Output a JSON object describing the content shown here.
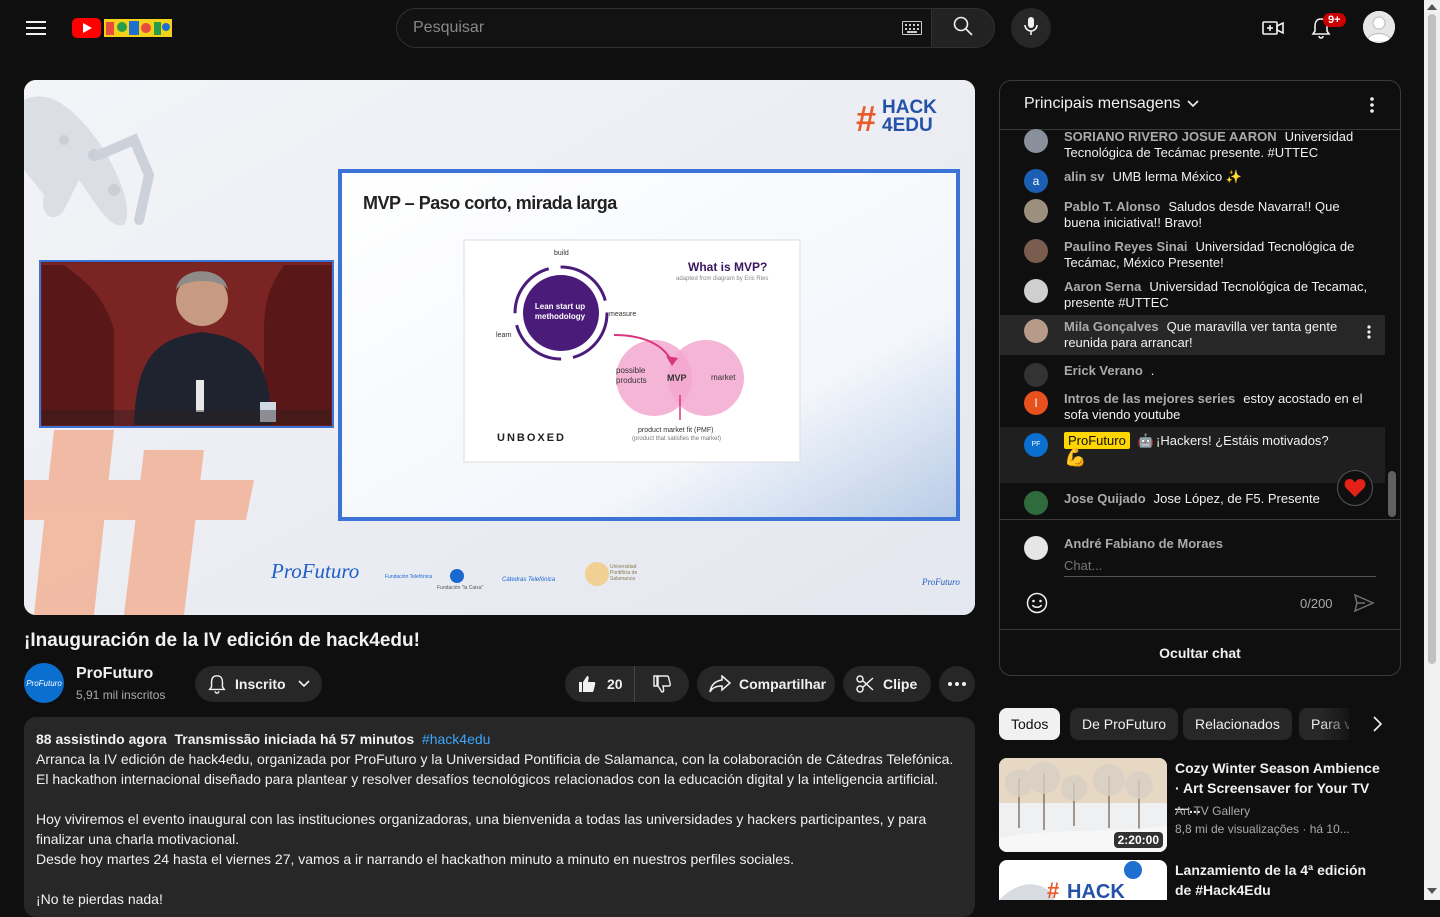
{
  "header": {
    "search_placeholder": "Pesquisar",
    "notif_count": "9+"
  },
  "video": {
    "slide_title": "MVP – Paso corto, mirada larga",
    "hack_logo_line1": "HACK",
    "hack_logo_line2": "4EDU",
    "mvp_heading": "What is MVP?",
    "mvp_sub": "adapted from diagram by Eric Ries",
    "cycle_center": "Lean start up methodology",
    "cycle_build": "build",
    "cycle_measure": "measure",
    "cycle_learn": "learn",
    "venn_left": "possible products",
    "venn_center": "MVP",
    "venn_right": "market",
    "venn_bottom": "product market fit (PMF)",
    "venn_bottom_sub": "(product that satisfies the market)",
    "unboxed": "UNBOXED",
    "footer_logo": "ProFuturo",
    "sponsor1": "Fundación Telefónica",
    "sponsor2": "Fundación \"la Caixa\"",
    "sponsor3": "Cátedras Telefónica",
    "sponsor4": "Universidad Pontificia de Salamanca",
    "corner_logo": "ProFuturo"
  },
  "title": "¡Inauguración de la IV edición de hack4edu!",
  "channel": {
    "name": "ProFuturo",
    "subs": "5,91 mil inscritos",
    "logo_text": "ProFuturo",
    "subscribed_label": "Inscrito"
  },
  "actions": {
    "likes": "20",
    "share": "Compartilhar",
    "clip": "Clipe"
  },
  "description": {
    "meta_watching": "88 assistindo agora",
    "meta_started": "Transmissão iniciada há 57 minutos",
    "meta_tag": "#hack4edu",
    "p1": "Arranca la IV edición de hack4edu, organizada por ProFuturo y la Universidad Pontificia de Salamanca, con la colaboración de Cátedras Telefónica. El hackathon internacional diseñado para plantear y resolver desafíos tecnológicos relacionados con la educación digital y la inteligencia artificial.",
    "p2": "Hoy viviremos el evento inaugural con las instituciones organizadoras, una bienvenida a todas las universidades y hackers participantes, y para finalizar una charla motivacional.",
    "p3": "Desde hoy martes 24 hasta el viernes 27, vamos a ir narrando el hackathon minuto a minuto en nuestros perfiles sociales.",
    "p4": "¡No te pierdas nada!"
  },
  "chat": {
    "header": "Principais mensagens",
    "messages": [
      {
        "author": "SORIANO RIVERO JOSUE AARON",
        "text": "Universidad Tecnológica de Tecámac presente. #UTTEC",
        "avatar": "",
        "avatar_color": "#8a8f9c"
      },
      {
        "author": "alin sv",
        "text": "UMB lerma México ✨",
        "avatar": "a",
        "avatar_color": "#1a5fb4"
      },
      {
        "author": "Pablo T. Alonso",
        "text": "Saludos desde Navarra!! Que buena iniciativa!! Bravo!",
        "avatar": "",
        "avatar_color": "#9c8f7e"
      },
      {
        "author": "Paulino Reyes Sinai",
        "text": "Universidad Tecnológica de Tecámac, México Presente!",
        "avatar": "",
        "avatar_color": "#7a5c4f"
      },
      {
        "author": "Aaron Serna",
        "text": "Universidad Tecnológica de Tecamac, presente #UTTEC",
        "avatar": "",
        "avatar_color": "#cfcfcf"
      },
      {
        "author": "Mila Gonçalves",
        "text": "Que maravilla ver tanta gente reunida para arrancar!",
        "avatar": "",
        "avatar_color": "#b89a8a"
      },
      {
        "author": "Erick Verano",
        "text": ".",
        "avatar": "",
        "avatar_color": "#333333"
      },
      {
        "author": "Intros de las mejores series",
        "text": "estoy acostado en el sofa viendo youtube",
        "avatar": "I",
        "avatar_color": "#e8501e"
      },
      {
        "author": "ProFuturo",
        "text": "¡Hackers! ¿Estáis motivados?",
        "avatar": "PF",
        "avatar_color": "#0b6fcf"
      },
      {
        "author": "Jose Quijado",
        "text": "Jose López, de F5. Presente",
        "avatar": "",
        "avatar_color": "#2f6b3c"
      }
    ],
    "input_user": "André Fabiano de Moraes",
    "input_placeholder": "Chat...",
    "char_count": "0/200",
    "hide_chat": "Ocultar chat"
  },
  "chips": [
    "Todos",
    "De ProFuturo",
    "Relacionados",
    "Para você"
  ],
  "recommendations": [
    {
      "title": "Cozy Winter Season Ambience · Art Screensaver for Your TV —...",
      "channel": "Art TV Gallery",
      "meta": "8,8 mi de visualizações · há 10...",
      "duration": "2:20:00"
    },
    {
      "title": "Lanzamiento de la 4ª edición de #Hack4Edu",
      "channel": "",
      "meta": "",
      "duration": ""
    }
  ],
  "colors": {
    "accent_red": "#ff0000",
    "hack_pink": "#e85a2a",
    "slide_border": "#3b73d6"
  }
}
